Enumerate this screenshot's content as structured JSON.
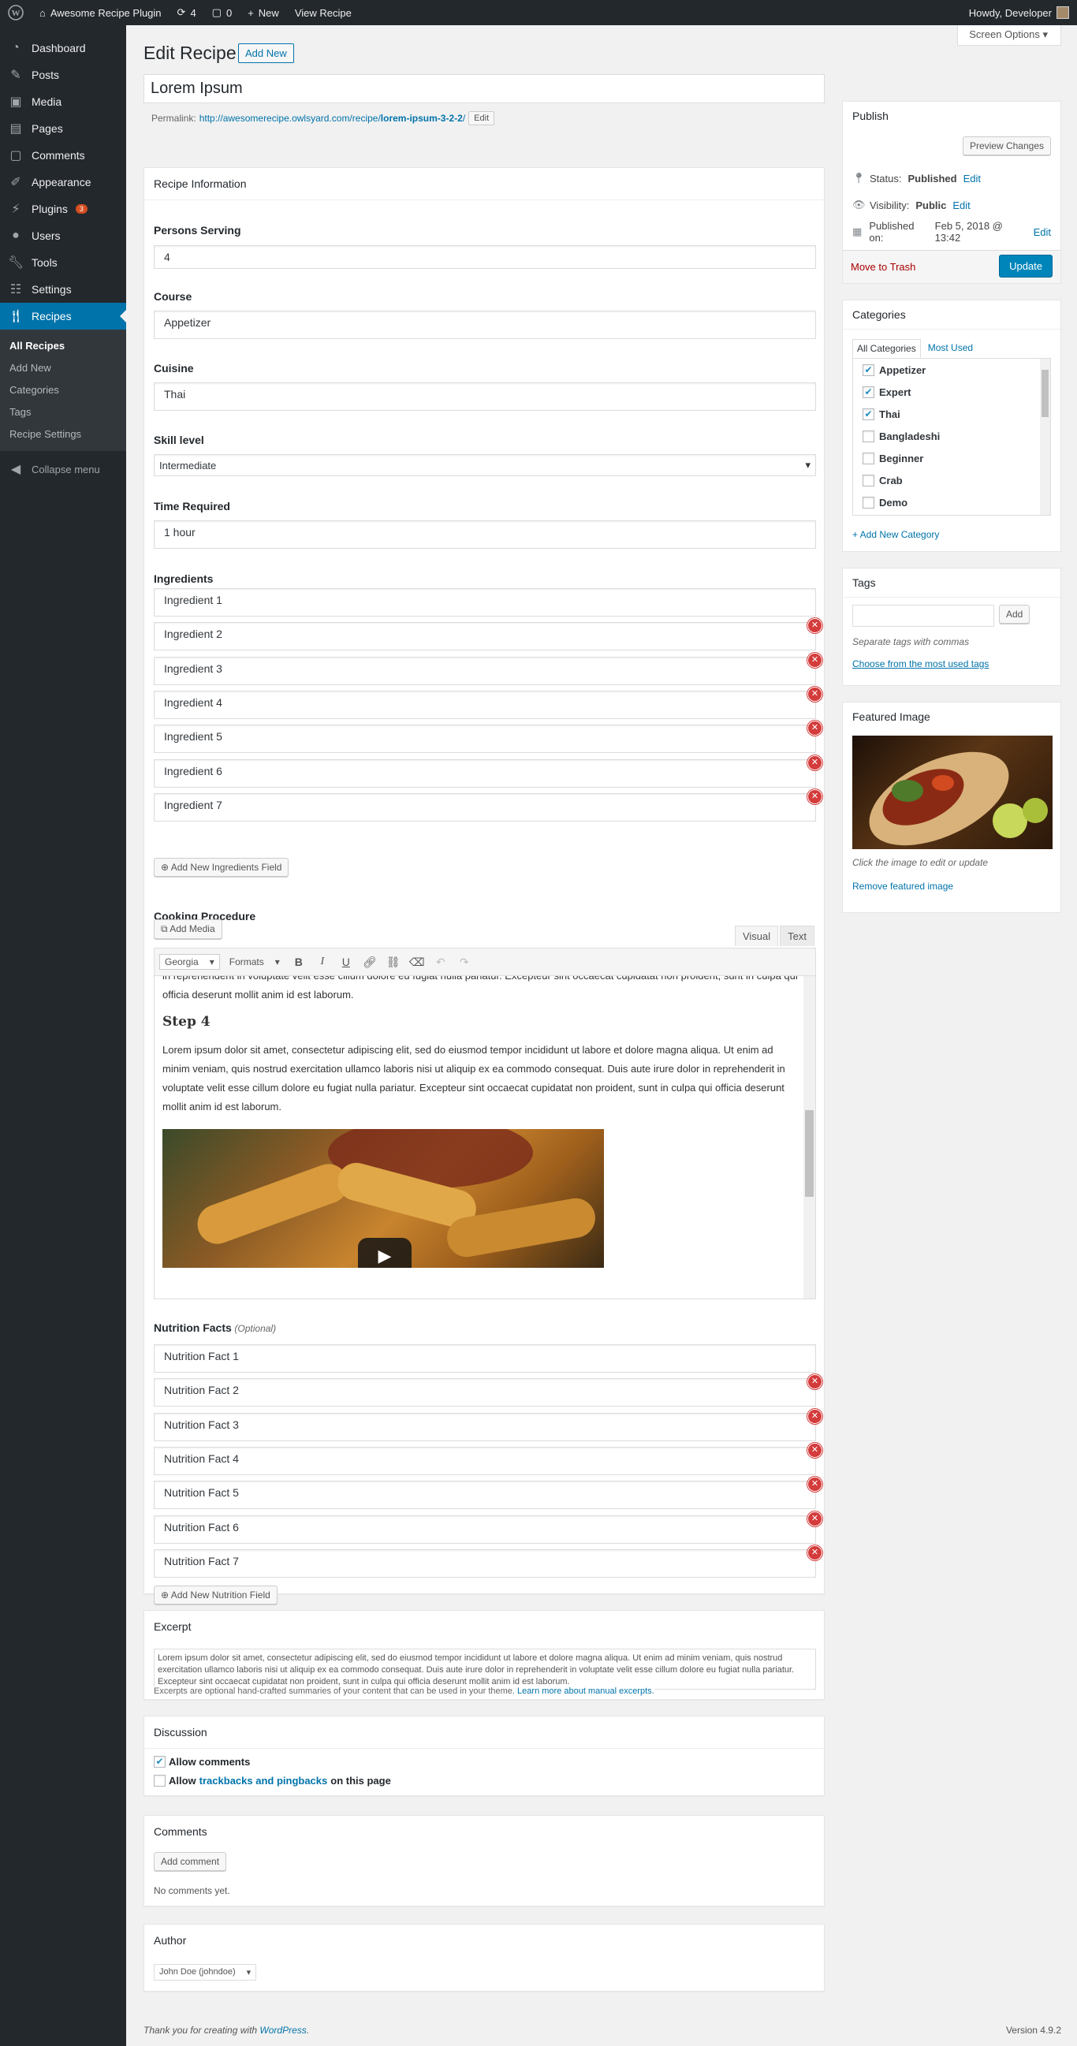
{
  "adminbar": {
    "site_name": "Awesome Recipe Plugin",
    "updates_count": "4",
    "comments_count": "0",
    "new_label": "New",
    "view_label": "View Recipe",
    "howdy": "Howdy, Developer"
  },
  "menu": {
    "items": [
      {
        "label": "Dashboard"
      },
      {
        "label": "Posts"
      },
      {
        "label": "Media"
      },
      {
        "label": "Pages"
      },
      {
        "label": "Comments"
      },
      {
        "label": "Appearance"
      },
      {
        "label": "Plugins"
      },
      {
        "label": "Users"
      },
      {
        "label": "Tools"
      },
      {
        "label": "Settings"
      },
      {
        "label": "Recipes"
      }
    ],
    "plugins_badge": "3",
    "submenu": [
      "All Recipes",
      "Add New",
      "Categories",
      "Tags",
      "Recipe Settings"
    ],
    "collapse": "Collapse menu"
  },
  "screen_options": "Screen Options",
  "page": {
    "title": "Edit Recipe",
    "add_new": "Add New"
  },
  "post": {
    "title": "Lorem Ipsum",
    "permalink_label": "Permalink:",
    "permalink_base": "http://awesomerecipe.owlsyard.com/recipe/",
    "permalink_slug": "lorem-ipsum-3-2-2",
    "permalink_end": "/",
    "edit_btn": "Edit"
  },
  "recipe_info": {
    "heading": "Recipe Information",
    "persons_label": "Persons Serving",
    "persons": "4",
    "course_label": "Course",
    "course": "Appetizer",
    "cuisine_label": "Cuisine",
    "cuisine": "Thai",
    "skill_label": "Skill level",
    "skill": "Intermediate",
    "time_label": "Time Required",
    "time": "1 hour",
    "ingredients_label": "Ingredients",
    "ingredients": [
      "Ingredient 1",
      "Ingredient 2",
      "Ingredient 3",
      "Ingredient 4",
      "Ingredient 5",
      "Ingredient 6",
      "Ingredient 7"
    ],
    "add_ingredient": "Add New Ingredients Field",
    "procedure_label": "Cooking Procedure",
    "add_media": "Add Media",
    "tab_visual": "Visual",
    "tab_text": "Text",
    "font_select": "Georgia",
    "formats_select": "Formats",
    "editor_para_top": "in reprehenderit in voluptate velit esse cillum dolore eu fugiat nulla pariatur. Excepteur sint occaecat cupidatat non proident, sunt in culpa qui officia deserunt mollit anim id est laborum.",
    "editor_step": "Step 4",
    "editor_para": "Lorem ipsum dolor sit amet, consectetur adipiscing elit, sed do eiusmod tempor incididunt ut labore et dolore magna aliqua. Ut enim ad minim veniam, quis nostrud exercitation ullamco laboris nisi ut aliquip ex ea commodo consequat. Duis aute irure dolor in reprehenderit in voluptate velit esse cillum dolore eu fugiat nulla pariatur. Excepteur sint occaecat cupidatat non proident, sunt in culpa qui officia deserunt mollit anim id est laborum.",
    "nutrition_label": "Nutrition Facts",
    "nutrition_optional": "(Optional)",
    "nutrition": [
      "Nutrition Fact 1",
      "Nutrition Fact 2",
      "Nutrition Fact 3",
      "Nutrition Fact 4",
      "Nutrition Fact 5",
      "Nutrition Fact 6",
      "Nutrition Fact 7"
    ],
    "add_nutrition": "Add New Nutrition Field"
  },
  "excerpt": {
    "heading": "Excerpt",
    "text": "Lorem ipsum dolor sit amet, consectetur adipiscing elit, sed do eiusmod tempor incididunt ut labore et dolore magna aliqua. Ut enim ad minim veniam, quis nostrud exercitation ullamco laboris nisi ut aliquip ex ea commodo consequat. Duis aute irure dolor in reprehenderit in voluptate velit esse cillum dolore eu fugiat nulla pariatur. Excepteur sint occaecat cupidatat non proident, sunt in culpa qui officia deserunt mollit anim id est laborum.",
    "help": "Excerpts are optional hand-crafted summaries of your content that can be used in your theme.",
    "help_link": "Learn more about manual excerpts."
  },
  "discussion": {
    "heading": "Discussion",
    "allow_comments": "Allow comments",
    "allow_pre": "Allow",
    "allow_link": "trackbacks and pingbacks",
    "allow_post": "on this page"
  },
  "comments": {
    "heading": "Comments",
    "add": "Add comment",
    "none": "No comments yet."
  },
  "author": {
    "heading": "Author",
    "value": "John Doe (johndoe)"
  },
  "publish": {
    "heading": "Publish",
    "preview": "Preview Changes",
    "status_label": "Status:",
    "status": "Published",
    "visibility_label": "Visibility:",
    "visibility": "Public",
    "published_label": "Published on:",
    "published": "Feb 5, 2018 @ 13:42",
    "edit": "Edit",
    "trash": "Move to Trash",
    "update": "Update"
  },
  "categories": {
    "heading": "Categories",
    "tab_all": "All Categories",
    "tab_used": "Most Used",
    "items": [
      {
        "label": "Appetizer",
        "checked": true
      },
      {
        "label": "Expert",
        "checked": true
      },
      {
        "label": "Thai",
        "checked": true
      },
      {
        "label": "Bangladeshi",
        "checked": false
      },
      {
        "label": "Beginner",
        "checked": false
      },
      {
        "label": "Crab",
        "checked": false
      },
      {
        "label": "Demo",
        "checked": false
      }
    ],
    "add_new": "+ Add New Category"
  },
  "tags": {
    "heading": "Tags",
    "add": "Add",
    "hint": "Separate tags with commas",
    "choose": "Choose from the most used tags"
  },
  "featured": {
    "heading": "Featured Image",
    "hint": "Click the image to edit or update",
    "remove": "Remove featured image"
  },
  "footer": {
    "thanks_pre": "Thank you for creating with",
    "thanks_link": "WordPress",
    "thanks_post": ".",
    "version": "Version 4.9.2"
  }
}
